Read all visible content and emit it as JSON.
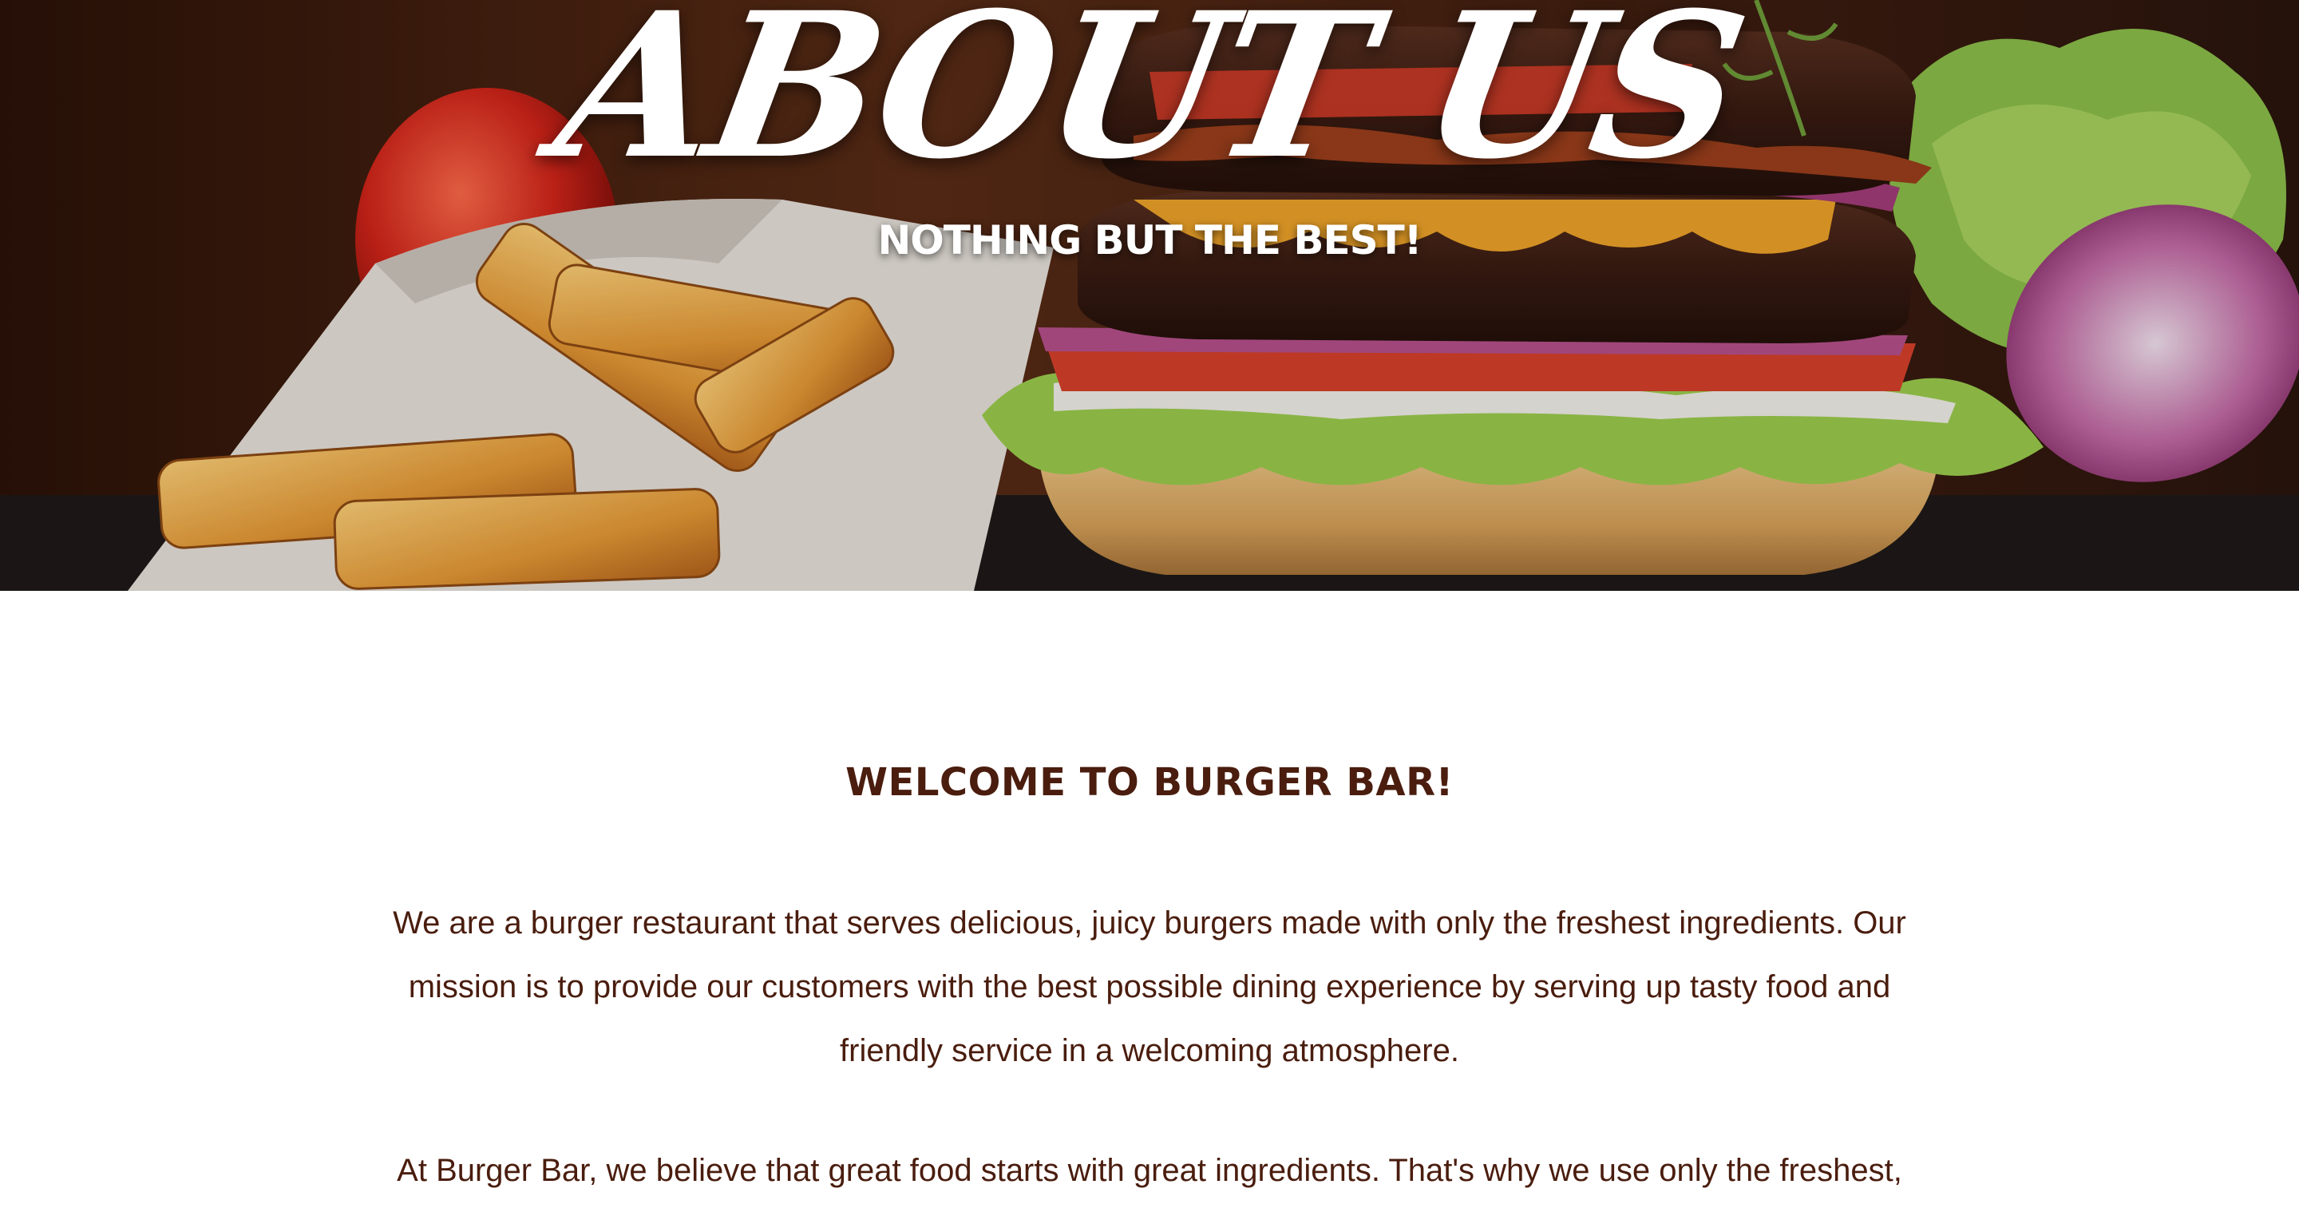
{
  "hero": {
    "title": "ABOUT US",
    "subtitle": "NOTHING BUT THE BEST!"
  },
  "welcome": {
    "heading": "WELCOME TO BURGER BAR!",
    "paragraph_1": "We are a burger restaurant that serves delicious, juicy burgers made with only the freshest ingredients. Our mission is to provide our customers with the best possible dining experience by serving up tasty food and friendly service in a welcoming atmosphere.",
    "paragraph_2": "At Burger Bar, we believe that great food starts with great ingredients. That's why we use only the freshest, highest quality ingredients in all of our dishes. Our beef is sourced from local farms and is never frozen."
  },
  "colors": {
    "heading_brown": "#4a1d0e",
    "hero_text": "#ffffff"
  }
}
